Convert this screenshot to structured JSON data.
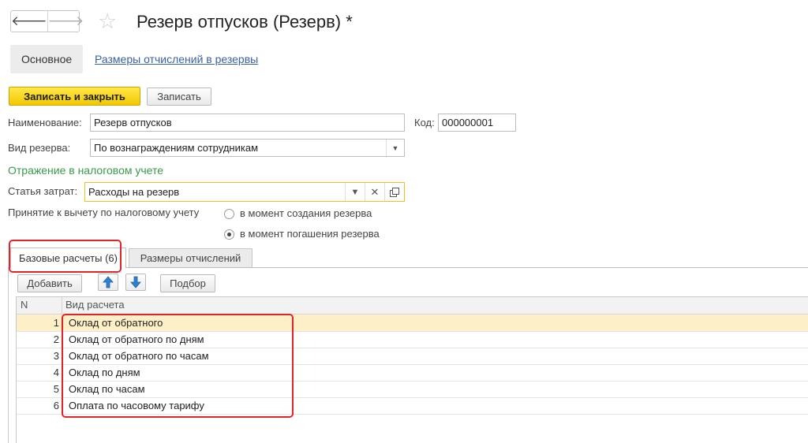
{
  "header": {
    "back_arrow": "🡐",
    "forward_arrow": "🡒",
    "title": "Резерв отпусков (Резерв) *"
  },
  "top_tabs": {
    "main": "Основное",
    "link": "Размеры отчислений в резервы"
  },
  "toolbar": {
    "save_close": "Записать и закрыть",
    "save": "Записать"
  },
  "form": {
    "name_label": "Наименование:",
    "name_value": "Резерв отпусков",
    "code_label": "Код:",
    "code_value": "000000001",
    "type_label": "Вид резерва:",
    "type_value": "По вознаграждениям сотрудникам"
  },
  "tax": {
    "section_title": "Отражение в налоговом учете",
    "cost_label": "Статья затрат:",
    "cost_value": "Расходы на резерв",
    "deduction_label": "Принятие к вычету по налоговому учету",
    "option_create": "в момент создания резерва",
    "option_payoff": "в момент погашения резерва",
    "selected_option": "payoff"
  },
  "tabs": {
    "base": "Базовые расчеты (6)",
    "rates": "Размеры отчислений"
  },
  "table_toolbar": {
    "add": "Добавить",
    "pick": "Подбор"
  },
  "table": {
    "col_n": "N",
    "col_kind": "Вид расчета",
    "rows": [
      {
        "n": "1",
        "kind": "Оклад от обратного"
      },
      {
        "n": "2",
        "kind": "Оклад от обратного по дням"
      },
      {
        "n": "3",
        "kind": "Оклад от обратного по часам"
      },
      {
        "n": "4",
        "kind": "Оклад по дням"
      },
      {
        "n": "5",
        "kind": "Оклад по часам"
      },
      {
        "n": "6",
        "kind": "Оплата по часовому тарифу"
      }
    ]
  },
  "colors": {
    "primary_button": "#f2c800",
    "link": "#3a62a0",
    "section_title": "#3a9a4a",
    "highlight_box": "#e0242a",
    "selected_row": "#fdf0c8"
  }
}
